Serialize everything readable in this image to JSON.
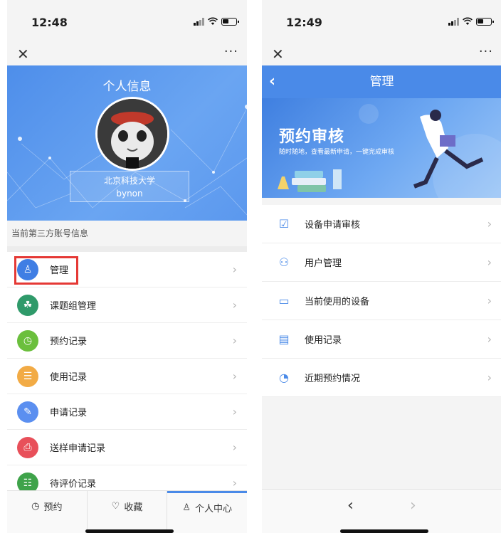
{
  "left": {
    "time": "12:48",
    "close_icon": "close-icon",
    "more_label": "···",
    "header_title": "个人信息",
    "account": {
      "school": "北京科技大学",
      "username": "bynon"
    },
    "section_label": "当前第三方账号信息",
    "menu": [
      {
        "label": "管理",
        "icon": "user-icon",
        "color": "#3f7ee4",
        "glyph": "♙"
      },
      {
        "label": "课题组管理",
        "icon": "group-icon",
        "color": "#2f9a6a",
        "glyph": "☘"
      },
      {
        "label": "预约记录",
        "icon": "calendar-icon",
        "color": "#6bbf3d",
        "glyph": "◷"
      },
      {
        "label": "使用记录",
        "icon": "document-icon",
        "color": "#f2ab45",
        "glyph": "☰"
      },
      {
        "label": "申请记录",
        "icon": "edit-icon",
        "color": "#5b8ff0",
        "glyph": "✎"
      },
      {
        "label": "送样申请记录",
        "icon": "sample-icon",
        "color": "#e8505a",
        "glyph": "⎙"
      },
      {
        "label": "待评价记录",
        "icon": "comment-icon",
        "color": "#3fa34a",
        "glyph": "☷"
      }
    ],
    "tabs": [
      {
        "label": "预约",
        "icon": "calendar-icon",
        "glyph": "◷"
      },
      {
        "label": "收藏",
        "icon": "heart-icon",
        "glyph": "♡"
      },
      {
        "label": "个人中心",
        "icon": "person-icon",
        "glyph": "♙"
      }
    ]
  },
  "right": {
    "time": "12:49",
    "more_label": "···",
    "title": "管理",
    "banner_title": "预约审核",
    "banner_subtitle": "随时随地，查看最新申请，一键完成审核",
    "menu": [
      {
        "label": "设备申请审核",
        "icon": "clipboard-check-icon",
        "glyph": "☑"
      },
      {
        "label": "用户管理",
        "icon": "users-icon",
        "glyph": "⚇"
      },
      {
        "label": "当前使用的设备",
        "icon": "monitor-icon",
        "glyph": "▭"
      },
      {
        "label": "使用记录",
        "icon": "file-icon",
        "glyph": "▤"
      },
      {
        "label": "近期预约情况",
        "icon": "clock-icon",
        "glyph": "◔"
      }
    ]
  }
}
